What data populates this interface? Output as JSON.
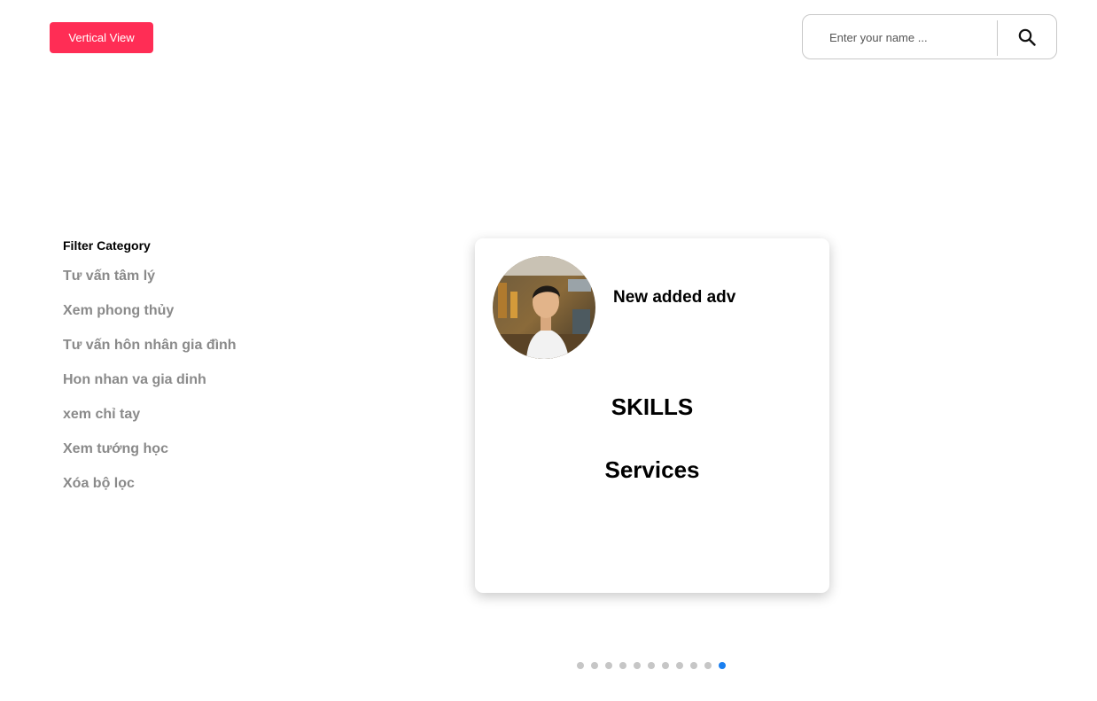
{
  "header": {
    "view_toggle_label": "Vertical View",
    "search_placeholder": "Enter your name ...",
    "search_icon": "search-icon"
  },
  "filter": {
    "title": "Filter Category",
    "items": [
      "Tư vấn tâm lý",
      "Xem phong thủy",
      "Tư vấn hôn nhân gia đình",
      "Hon nhan va gia dinh",
      "xem chỉ tay",
      "Xem tướng học",
      "Xóa bộ lọc"
    ]
  },
  "card": {
    "name": "New added adv",
    "skills_heading": "SKILLS",
    "services_heading": "Services",
    "avatar": "avatar-photo"
  },
  "pagination": {
    "total": 11,
    "active_index": 10
  },
  "colors": {
    "accent": "#ff2d55",
    "active_dot": "#1a7ff0",
    "inactive_dot": "#c6c6c6",
    "filter_text": "#8a8a8a"
  }
}
